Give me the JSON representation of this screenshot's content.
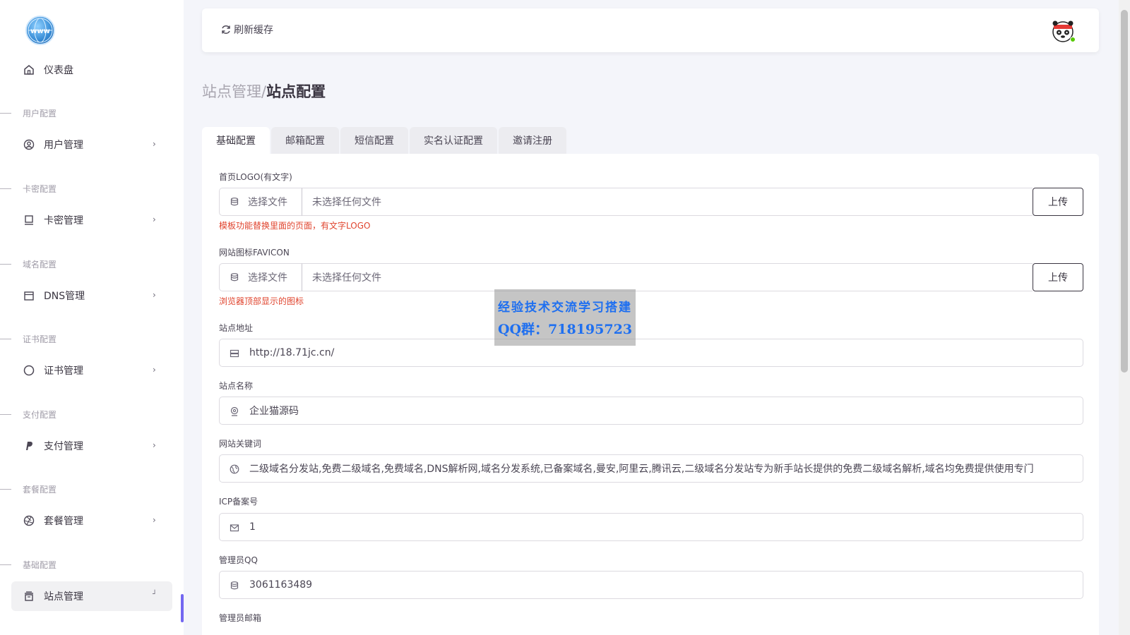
{
  "sidebar": {
    "logo_icon": "globe-www-icon",
    "items": [
      {
        "label": "仪表盘",
        "icon": "home-icon"
      },
      {
        "section": "用户配置",
        "label": "用户管理",
        "icon": "user-circle-icon"
      },
      {
        "section": "卡密配置",
        "label": "卡密管理",
        "icon": "monitor-icon"
      },
      {
        "section": "域名配置",
        "label": "DNS管理",
        "icon": "calendar-icon"
      },
      {
        "section": "证书配置",
        "label": "证书管理",
        "icon": "circle-icon"
      },
      {
        "section": "支付配置",
        "label": "支付管理",
        "icon": "paypal-icon"
      },
      {
        "section": "套餐配置",
        "label": "套餐管理",
        "icon": "aperture-icon"
      },
      {
        "section": "基础配置",
        "label": "站点管理",
        "icon": "archive-icon"
      }
    ]
  },
  "topbar": {
    "refresh_label": "刷新缓存",
    "refresh_icon": "refresh-icon",
    "avatar_icon": "panda-avatar-icon",
    "status_color": "#56ca00"
  },
  "breadcrumb": {
    "parent": "站点管理/",
    "current": "站点配置"
  },
  "tabs": [
    "基础配置",
    "邮箱配置",
    "短信配置",
    "实名认证配置",
    "邀请注册"
  ],
  "form": {
    "logo_label": "首页LOGO(有文字)",
    "logo_choose": "选择文件",
    "logo_filename": "未选择任何文件",
    "logo_upload": "上传",
    "logo_hint": "模板功能替换里面的页面，有文字LOGO",
    "favicon_label": "网站图标FAVICON",
    "favicon_choose": "选择文件",
    "favicon_filename": "未选择任何文件",
    "favicon_upload": "上传",
    "favicon_hint": "浏览器顶部显示的图标",
    "site_url_label": "站点地址",
    "site_url_value": "http://18.71jc.cn/",
    "site_name_label": "站点名称",
    "site_name_value": "企业猫源码",
    "keywords_label": "网站关键词",
    "keywords_value": "二级域名分发站,免费二级域名,免费域名,DNS解析网,域名分发系统,已备案域名,曼安,阿里云,腾讯云,二级域名分发站专为新手站长提供的免费二级域名解析,域名均免费提供使用专门",
    "icp_label": "ICP备案号",
    "icp_value": "1",
    "admin_qq_label": "管理员QQ",
    "admin_qq_value": "3061163489",
    "admin_email_label": "管理员邮箱"
  },
  "watermark": {
    "line1": "经验技术交流学习搭建",
    "line2": "QQ群：718195723"
  },
  "colors": {
    "accent": "#7367f0",
    "hint": "#e0442e",
    "watermark_text": "#1e6ff0"
  }
}
